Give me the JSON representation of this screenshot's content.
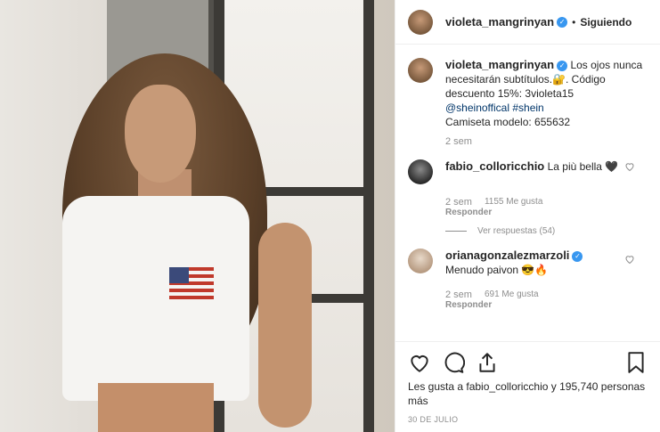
{
  "header": {
    "username": "violeta_mangrinyan",
    "separator": "•",
    "follow_label": "Siguiendo"
  },
  "caption": {
    "username": "violeta_mangrinyan",
    "text": "Los ojos nunca necesitarán subtítulos.🔐. Código descuento 15%: 3violeta15",
    "mention": "@sheinoffical",
    "hashtag": "#shein",
    "extra": "Camiseta modelo: 655632",
    "time": "2 sem"
  },
  "comments": [
    {
      "username": "fabio_colloricchio",
      "text": "La più bella 🖤",
      "time": "2 sem",
      "likes": "1155 Me gusta",
      "reply_label": "Responder",
      "view_replies": "Ver respuestas (54)"
    },
    {
      "username": "orianagonzalezmarzoli",
      "text": "Menudo paivon 😎🔥",
      "time": "2 sem",
      "likes": "691 Me gusta",
      "reply_label": "Responder"
    }
  ],
  "likes_summary": "Les gusta a fabio_colloricchio y 195,740 personas más",
  "date": "30 DE JULIO",
  "icons": [
    "heart-icon",
    "comment-icon",
    "share-icon",
    "bookmark-icon",
    "verified-icon"
  ],
  "colors": {
    "verified": "#3897f0",
    "link": "#003569",
    "muted": "#8e8e8e"
  }
}
